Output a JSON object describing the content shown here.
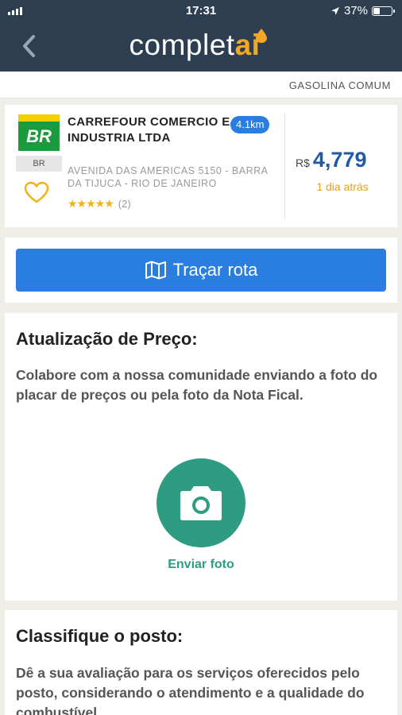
{
  "status_bar": {
    "time": "17:31",
    "battery": "37%"
  },
  "header": {
    "logo_main": "complet",
    "logo_accent": "ai",
    "icons": [
      "back-chevron-icon",
      "fuel-drop-icon"
    ]
  },
  "fuel_type": "GASOLINA COMUM",
  "station": {
    "name": "CARREFOUR COMERCIO E INDUSTRIA LTDA",
    "brand_tag": "BR",
    "brand_logo_text": "BR",
    "distance": "4.1km",
    "address": "AVENIDA DAS AMERICAS 5150 - BARRA DA TIJUCA - RIO DE JANEIRO",
    "stars": "★★★★★",
    "rating_value": 4.5,
    "rating_count": "(2)",
    "currency": "R$",
    "price": "4,779",
    "price_updated": "1 dia atrás"
  },
  "route": {
    "label": "Traçar rota",
    "icon": "map-icon"
  },
  "price_update": {
    "title": "Atualização de Preço:",
    "description": "Colabore com a nossa comunidade enviando a foto do placar de preços ou pela foto da Nota Fical.",
    "button_label": "Enviar foto",
    "icon": "camera-icon"
  },
  "classify": {
    "title": "Classifique o posto:",
    "description": "Dê a sua avaliação para os serviços oferecidos pelo posto, considerando o atendimento e a qualidade do combustível"
  },
  "colors": {
    "header_bg": "#2d3e50",
    "accent_orange": "#f5a623",
    "button_blue": "#2a7ee0",
    "price_blue": "#1f5aa6",
    "camera_green": "#2e9c82",
    "star_yellow": "#f2b21a"
  }
}
